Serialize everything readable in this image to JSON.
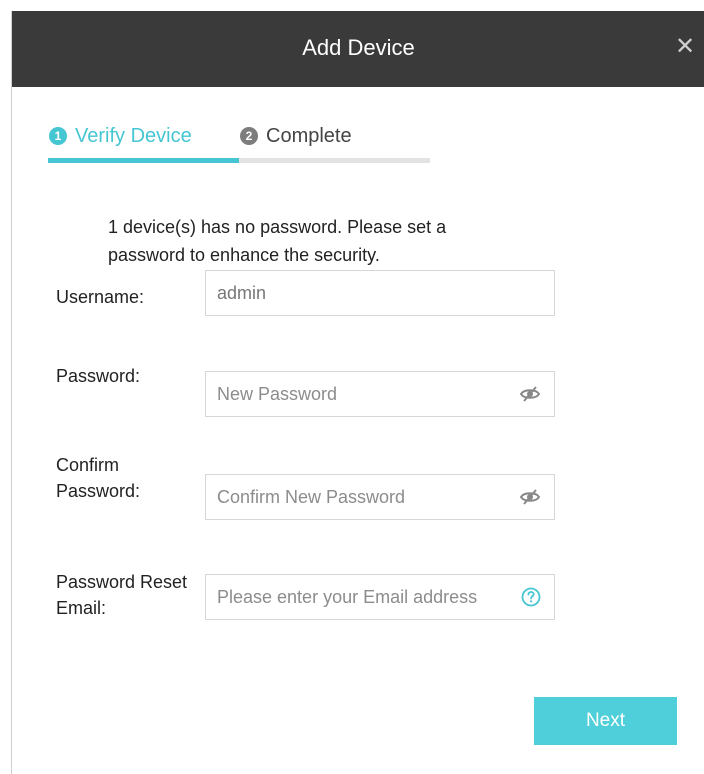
{
  "dialog": {
    "title": "Add Device",
    "close_glyph": "✕"
  },
  "steps": [
    {
      "number": "1",
      "label": "Verify Device",
      "state": "active"
    },
    {
      "number": "2",
      "label": "Complete",
      "state": "inactive"
    }
  ],
  "info": "1 device(s) has no password. Please set a password to enhance the security.",
  "form": {
    "username": {
      "label": "Username:",
      "value": "admin"
    },
    "password": {
      "label": "Password:",
      "placeholder": "New Password",
      "icon": "eye-off-icon"
    },
    "confirm_password": {
      "label_line1": "Confirm",
      "label_line2": "Password:",
      "placeholder": "Confirm New Password",
      "icon": "eye-off-icon"
    },
    "reset_email": {
      "label_line1": "Password Reset",
      "label_line2": "Email:",
      "placeholder": "Please enter your Email address",
      "icon": "help-icon"
    }
  },
  "actions": {
    "next_label": "Next"
  },
  "colors": {
    "accent": "#45c6d2",
    "titlebar": "#3a3a3a",
    "button": "#4fcfd9"
  }
}
